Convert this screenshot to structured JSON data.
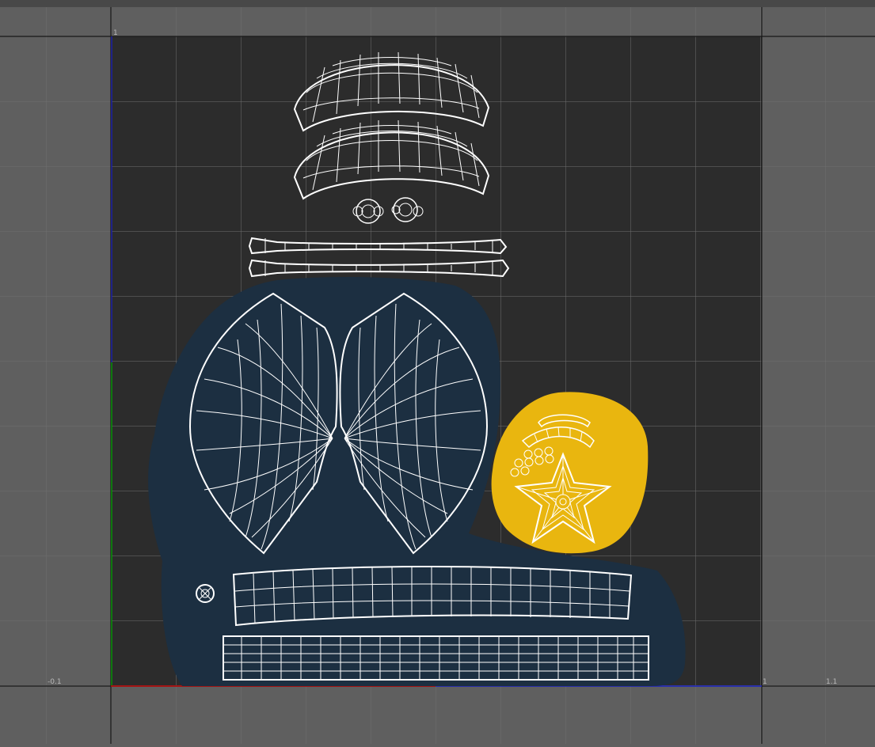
{
  "editor": {
    "axis_labels": {
      "v_one": "1",
      "u_neg": "-0.1",
      "u_one": "1",
      "u_one_tenth": "1.1"
    }
  },
  "colors": {
    "background": "#5f5f5f",
    "uv_tile": "#2c2c2c",
    "grid_line": "#6f6f6f",
    "uv_wire": "#ffffff",
    "shirt_island_group": "#1c2f41",
    "badge_island_group": "#e9b60f",
    "u_axis": "#c00000",
    "v_axis": "#00b000",
    "border_axis": "#1d24c8"
  },
  "uv_shells": [
    {
      "name": "cap-brim-upper"
    },
    {
      "name": "cap-brim-lower"
    },
    {
      "name": "button-pair"
    },
    {
      "name": "strap-upper"
    },
    {
      "name": "strap-lower"
    },
    {
      "name": "shirt-panel-left"
    },
    {
      "name": "shirt-panel-right"
    },
    {
      "name": "waistband-upper"
    },
    {
      "name": "waistband-lower"
    },
    {
      "name": "small-button"
    },
    {
      "name": "badge-arc"
    },
    {
      "name": "badge-rivets"
    },
    {
      "name": "badge-star"
    }
  ]
}
